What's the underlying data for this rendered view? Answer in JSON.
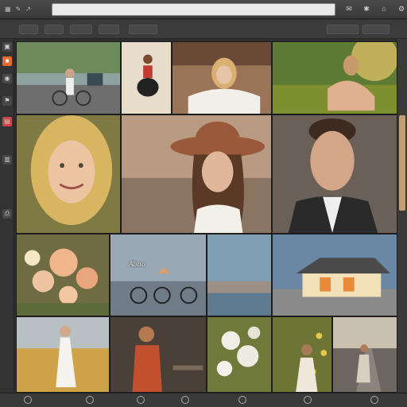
{
  "window": {
    "menu_icons": [
      "grid-icon",
      "edit-icon",
      "arrow-icon"
    ],
    "address_placeholder": "",
    "toolbar_right_icons": [
      "mail-icon",
      "star-icon",
      "tag-icon",
      "settings-icon"
    ]
  },
  "toolbar": {
    "buttons": [
      "",
      "",
      "",
      "",
      ""
    ],
    "right_buttons": [
      "",
      ""
    ]
  },
  "left_rail": {
    "icons": [
      "folder-icon",
      "import-icon",
      "globe-icon",
      "flag-icon",
      "gift-icon",
      "layer-icon",
      "print-icon"
    ]
  },
  "photos": [
    {
      "name": "couple-bicycle-photo"
    },
    {
      "name": "woman-chair-photo"
    },
    {
      "name": "woman-spa-photo"
    },
    {
      "name": "woman-field-photo"
    },
    {
      "name": "blonde-woman-portrait"
    },
    {
      "name": "woman-hat-portrait"
    },
    {
      "name": "man-portrait"
    },
    {
      "name": "roses-bouquet-photo"
    },
    {
      "name": "bicycles-pier-photo"
    },
    {
      "name": "sea-horizon-photo"
    },
    {
      "name": "house-sunset-photo"
    },
    {
      "name": "woman-wheat-field-photo"
    },
    {
      "name": "woman-red-dress-photo"
    },
    {
      "name": "white-flowers-photo"
    },
    {
      "name": "woman-flowers-photo"
    },
    {
      "name": "woman-road-photo"
    }
  ],
  "watermark": "Abzta",
  "bottom": {
    "icons": [
      "back-icon",
      "share-icon",
      "link-icon",
      "info-icon",
      "eye-icon",
      "tag-icon",
      "delete-icon"
    ]
  },
  "colors": {
    "accent": "#e86a2c",
    "chrome": "#3b3b3b"
  }
}
